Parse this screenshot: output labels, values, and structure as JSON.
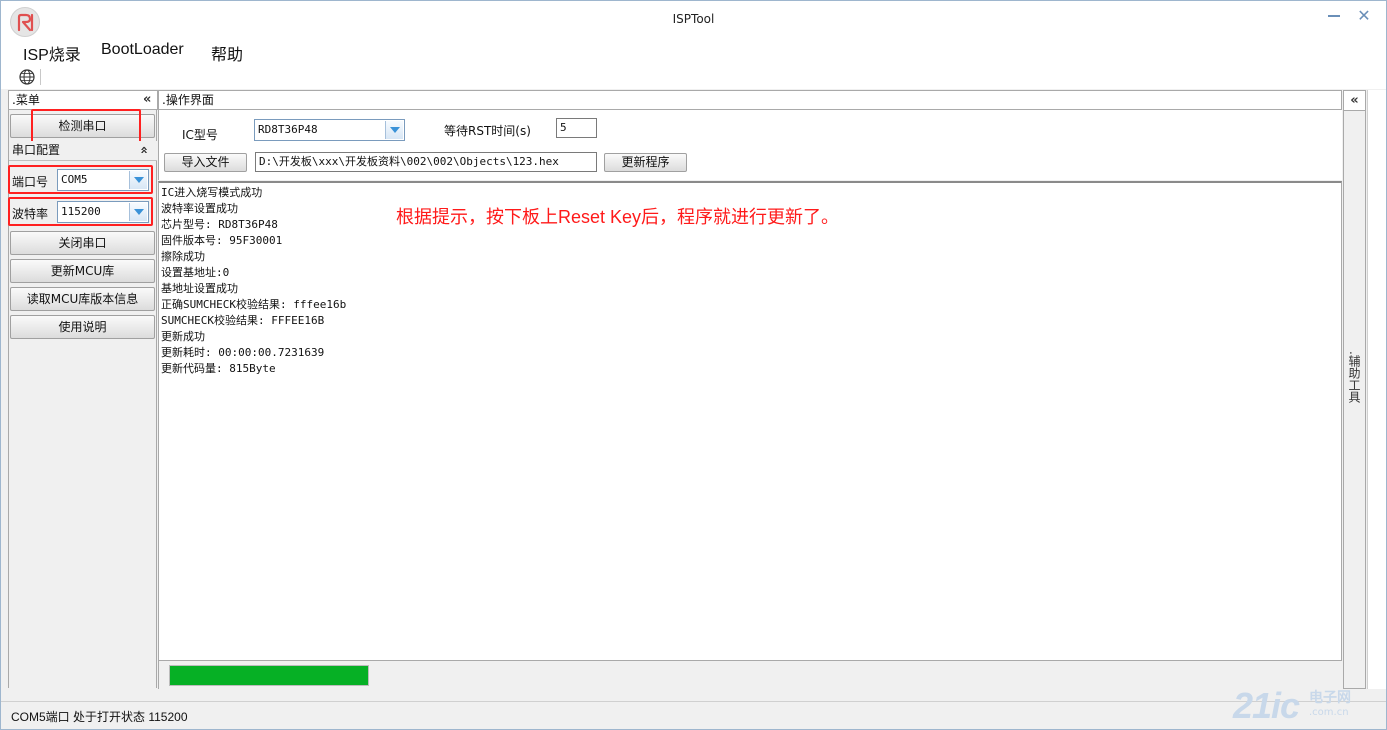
{
  "window": {
    "title": "ISPTool"
  },
  "menu": {
    "items": [
      "ISP烧录",
      "BootLoader",
      "帮助"
    ]
  },
  "left_panel": {
    "header": ".菜单",
    "collapse": "«",
    "detect_port_button": "检测串口",
    "serial_config_header": "串口配置",
    "serial_config_collapse": "»",
    "port_label": "端口号",
    "port_value": "COM5",
    "baud_label": "波特率",
    "baud_value": "115200",
    "close_port_button": "关闭串口",
    "update_mcu_button": "更新MCU库",
    "read_mcu_version_button": "读取MCU库版本信息",
    "usage_button": "使用说明"
  },
  "operation": {
    "header": ".操作界面",
    "ic_label": "IC型号",
    "ic_value": "RD8T36P48",
    "rst_wait_label": "等待RST时间(s)",
    "rst_wait_value": "5",
    "import_button": "导入文件",
    "file_path": "D:\\开发板\\xxx\\开发板资料\\002\\002\\Objects\\123.hex",
    "update_button": "更新程序"
  },
  "log": {
    "lines": [
      "IC进入烧写模式成功",
      "波特率设置成功",
      "芯片型号: RD8T36P48",
      "固件版本号: 95F30001",
      "擦除成功",
      "设置基地址:0",
      "基地址设置成功",
      "正确SUMCHECK校验结果: fffee16b",
      "SUMCHECK校验结果: FFFEE16B",
      "更新成功",
      "更新耗时: 00:00:00.7231639",
      "更新代码量: 815Byte"
    ]
  },
  "annotation": "根据提示，按下板上Reset Key后，程序就进行更新了。",
  "progress": {
    "fraction": 1.0,
    "color": "#06b025"
  },
  "right_panel": {
    "collapse": "«",
    "label": ".辅助工具"
  },
  "status": {
    "text": "COM5端口 处于打开状态 115200"
  },
  "watermark": {
    "logo": "21ic",
    "cn": "电子网",
    "url": ".com.cn"
  },
  "colors": {
    "highlight_box": "#ff2020",
    "annotation": "#ff1a1a"
  }
}
